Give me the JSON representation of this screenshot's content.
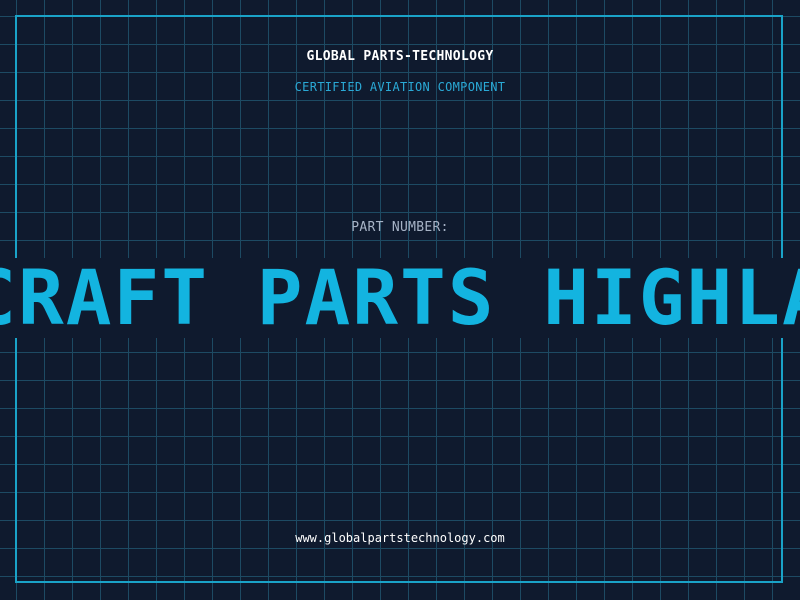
{
  "header": {
    "company": "GLOBAL PARTS-TECHNOLOGY",
    "subtitle": "CERTIFIED AVIATION COMPONENT"
  },
  "part": {
    "label": "PART NUMBER:",
    "number": "AIRCRAFT PARTS HIGHLANDS"
  },
  "footer": {
    "website": "www.globalpartstechnology.com"
  },
  "colors": {
    "background": "#0f1a2e",
    "grid": "#1d4a63",
    "frame": "#1aa3c8",
    "accent": "#13b4e0"
  }
}
